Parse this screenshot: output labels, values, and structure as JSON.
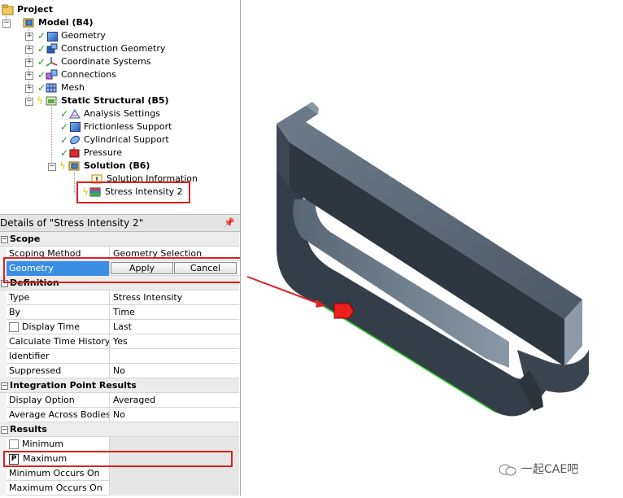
{
  "tree": {
    "project": "Project",
    "model": "Model (B4)",
    "geometry": "Geometry",
    "construction_geometry": "Construction Geometry",
    "coordinate_systems": "Coordinate Systems",
    "connections": "Connections",
    "mesh": "Mesh",
    "static_structural": "Static Structural (B5)",
    "analysis_settings": "Analysis Settings",
    "frictionless_support": "Frictionless Support",
    "cylindrical_support": "Cylindrical Support",
    "pressure": "Pressure",
    "solution": "Solution (B6)",
    "solution_information": "Solution Information",
    "stress_intensity": "Stress Intensity 2"
  },
  "details": {
    "title": "Details of \"Stress Intensity 2\"",
    "pin": "ᵖ",
    "sections": {
      "scope": "Scope",
      "definition": "Definition",
      "integration": "Integration Point Results",
      "results": "Results"
    },
    "rows": {
      "scoping_method": {
        "label": "Scoping Method",
        "value": "Geometry Selection"
      },
      "geometry": {
        "label": "Geometry",
        "apply": "Apply",
        "cancel": "Cancel"
      },
      "type": {
        "label": "Type",
        "value": "Stress Intensity"
      },
      "by": {
        "label": "By",
        "value": "Time"
      },
      "display_time": {
        "label": "Display Time",
        "value": "Last"
      },
      "calc_time_history": {
        "label": "Calculate Time History",
        "value": "Yes"
      },
      "identifier": {
        "label": "Identifier",
        "value": ""
      },
      "suppressed": {
        "label": "Suppressed",
        "value": "No"
      },
      "display_option": {
        "label": "Display Option",
        "value": "Averaged"
      },
      "avg_across_bodies": {
        "label": "Average Across Bodies",
        "value": "No"
      },
      "minimum": {
        "label": "Minimum",
        "value": ""
      },
      "maximum": {
        "label": "Maximum",
        "value": "",
        "badge": "P"
      },
      "min_occurs_on": {
        "label": "Minimum Occurs On",
        "value": ""
      },
      "max_occurs_on": {
        "label": "Maximum Occurs On",
        "value": ""
      }
    }
  },
  "watermark": "一起CAE吧",
  "colors": {
    "highlight": "#e02020",
    "selection": "#3a8ee6",
    "model_body": "#3b4652"
  }
}
